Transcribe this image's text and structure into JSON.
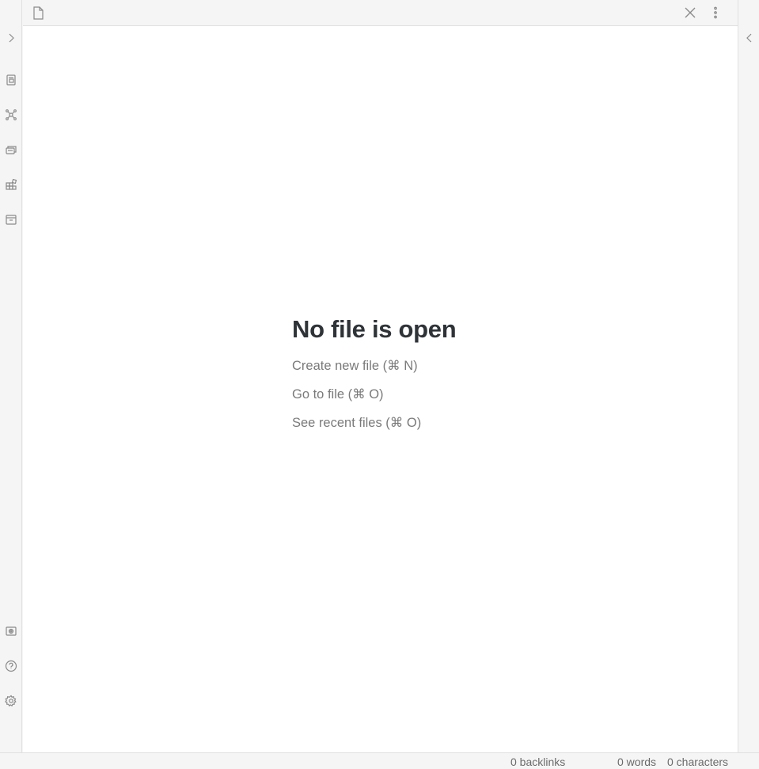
{
  "header": {
    "icons": [
      "file-icon",
      "close-icon",
      "more-options-icon"
    ]
  },
  "ribbon": {
    "top_icons": [
      "expand-sidebar-icon",
      "switcher-icon",
      "graph-view-icon",
      "slides-icon",
      "kanban-icon",
      "calendar-icon"
    ],
    "bottom_icons": [
      "vault-icon",
      "help-icon",
      "settings-icon"
    ]
  },
  "empty_state": {
    "title": "No file is open",
    "actions": [
      {
        "label": "Create new file (⌘ N)"
      },
      {
        "label": "Go to file (⌘ O)"
      },
      {
        "label": "See recent files (⌘ O)"
      }
    ]
  },
  "status_bar": {
    "backlinks": "0 backlinks",
    "words": "0 words",
    "characters": "0 characters"
  }
}
